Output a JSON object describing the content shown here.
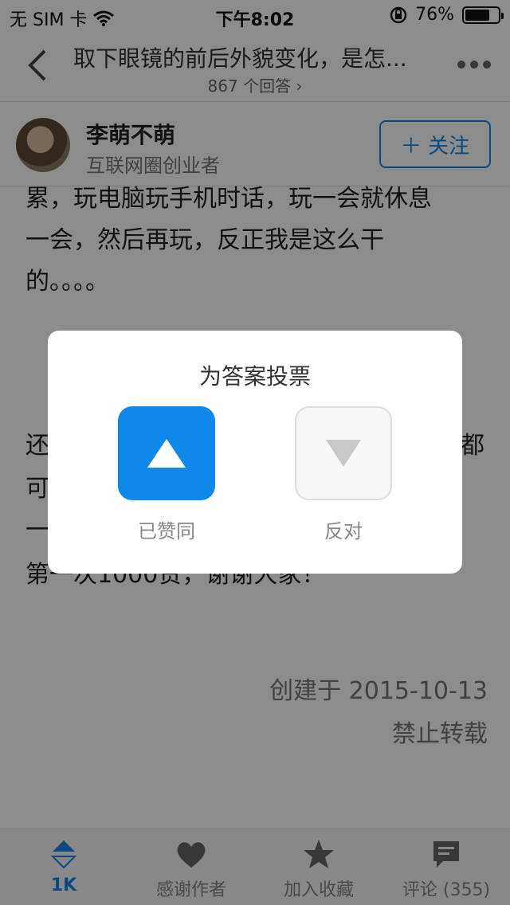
{
  "status_bar": {
    "carrier": "无 SIM 卡",
    "time": "下午8:02",
    "battery": "76%",
    "battery_level": 0.76
  },
  "nav": {
    "title": "取下眼镜的前后外貌变化，是怎...",
    "subtitle": "867 个回答 ›"
  },
  "author": {
    "name": "李萌不萌",
    "bio": "互联网圈创业者",
    "follow_label": "＋ 关注"
  },
  "article": {
    "lines_top": [
      "累，玩电脑玩手机时话，玩一会就休息",
      "一会，然后再玩，反正我是这么干",
      "的。。。。"
    ],
    "lines_bottom_partial": [
      "还",
      "都",
      "可",
      "一",
      "第一次1000赞，谢谢大家！"
    ],
    "created": "创建于 2015-10-13",
    "copyright": "禁止转载"
  },
  "tabbar": {
    "items": [
      {
        "label": "1K",
        "icon": "vote-icon"
      },
      {
        "label": "感谢作者",
        "icon": "heart-icon"
      },
      {
        "label": "加入收藏",
        "icon": "star-icon"
      },
      {
        "label": "评论 (355)",
        "icon": "comment-icon"
      }
    ]
  },
  "vote_dialog": {
    "title": "为答案投票",
    "upvote_label": "已赞同",
    "downvote_label": "反对"
  },
  "colors": {
    "accent": "#0f88eb",
    "overlay": "rgba(0,0,0,0.45)"
  }
}
